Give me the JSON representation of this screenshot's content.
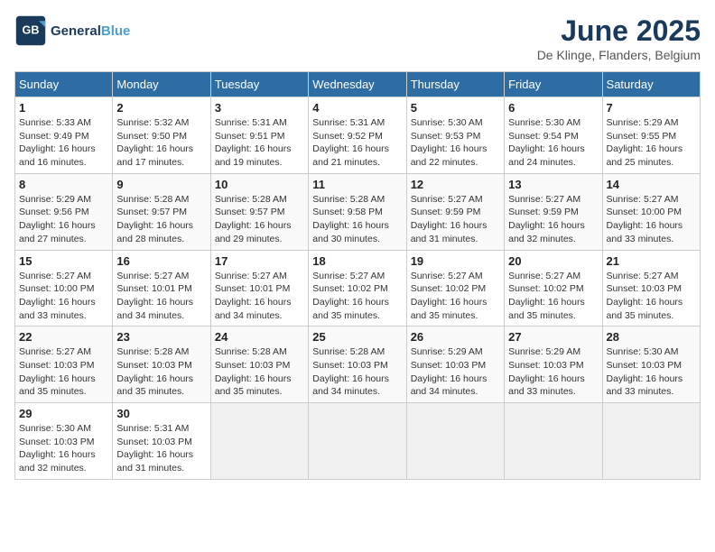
{
  "header": {
    "logo_general": "General",
    "logo_blue": "Blue",
    "month_title": "June 2025",
    "location": "De Klinge, Flanders, Belgium"
  },
  "days_of_week": [
    "Sunday",
    "Monday",
    "Tuesday",
    "Wednesday",
    "Thursday",
    "Friday",
    "Saturday"
  ],
  "weeks": [
    [
      {
        "day": "1",
        "sunrise": "5:33 AM",
        "sunset": "9:49 PM",
        "daylight": "16 hours and 16 minutes."
      },
      {
        "day": "2",
        "sunrise": "5:32 AM",
        "sunset": "9:50 PM",
        "daylight": "16 hours and 17 minutes."
      },
      {
        "day": "3",
        "sunrise": "5:31 AM",
        "sunset": "9:51 PM",
        "daylight": "16 hours and 19 minutes."
      },
      {
        "day": "4",
        "sunrise": "5:31 AM",
        "sunset": "9:52 PM",
        "daylight": "16 hours and 21 minutes."
      },
      {
        "day": "5",
        "sunrise": "5:30 AM",
        "sunset": "9:53 PM",
        "daylight": "16 hours and 22 minutes."
      },
      {
        "day": "6",
        "sunrise": "5:30 AM",
        "sunset": "9:54 PM",
        "daylight": "16 hours and 24 minutes."
      },
      {
        "day": "7",
        "sunrise": "5:29 AM",
        "sunset": "9:55 PM",
        "daylight": "16 hours and 25 minutes."
      }
    ],
    [
      {
        "day": "8",
        "sunrise": "5:29 AM",
        "sunset": "9:56 PM",
        "daylight": "16 hours and 27 minutes."
      },
      {
        "day": "9",
        "sunrise": "5:28 AM",
        "sunset": "9:57 PM",
        "daylight": "16 hours and 28 minutes."
      },
      {
        "day": "10",
        "sunrise": "5:28 AM",
        "sunset": "9:57 PM",
        "daylight": "16 hours and 29 minutes."
      },
      {
        "day": "11",
        "sunrise": "5:28 AM",
        "sunset": "9:58 PM",
        "daylight": "16 hours and 30 minutes."
      },
      {
        "day": "12",
        "sunrise": "5:27 AM",
        "sunset": "9:59 PM",
        "daylight": "16 hours and 31 minutes."
      },
      {
        "day": "13",
        "sunrise": "5:27 AM",
        "sunset": "9:59 PM",
        "daylight": "16 hours and 32 minutes."
      },
      {
        "day": "14",
        "sunrise": "5:27 AM",
        "sunset": "10:00 PM",
        "daylight": "16 hours and 33 minutes."
      }
    ],
    [
      {
        "day": "15",
        "sunrise": "5:27 AM",
        "sunset": "10:00 PM",
        "daylight": "16 hours and 33 minutes."
      },
      {
        "day": "16",
        "sunrise": "5:27 AM",
        "sunset": "10:01 PM",
        "daylight": "16 hours and 34 minutes."
      },
      {
        "day": "17",
        "sunrise": "5:27 AM",
        "sunset": "10:01 PM",
        "daylight": "16 hours and 34 minutes."
      },
      {
        "day": "18",
        "sunrise": "5:27 AM",
        "sunset": "10:02 PM",
        "daylight": "16 hours and 35 minutes."
      },
      {
        "day": "19",
        "sunrise": "5:27 AM",
        "sunset": "10:02 PM",
        "daylight": "16 hours and 35 minutes."
      },
      {
        "day": "20",
        "sunrise": "5:27 AM",
        "sunset": "10:02 PM",
        "daylight": "16 hours and 35 minutes."
      },
      {
        "day": "21",
        "sunrise": "5:27 AM",
        "sunset": "10:03 PM",
        "daylight": "16 hours and 35 minutes."
      }
    ],
    [
      {
        "day": "22",
        "sunrise": "5:27 AM",
        "sunset": "10:03 PM",
        "daylight": "16 hours and 35 minutes."
      },
      {
        "day": "23",
        "sunrise": "5:28 AM",
        "sunset": "10:03 PM",
        "daylight": "16 hours and 35 minutes."
      },
      {
        "day": "24",
        "sunrise": "5:28 AM",
        "sunset": "10:03 PM",
        "daylight": "16 hours and 35 minutes."
      },
      {
        "day": "25",
        "sunrise": "5:28 AM",
        "sunset": "10:03 PM",
        "daylight": "16 hours and 34 minutes."
      },
      {
        "day": "26",
        "sunrise": "5:29 AM",
        "sunset": "10:03 PM",
        "daylight": "16 hours and 34 minutes."
      },
      {
        "day": "27",
        "sunrise": "5:29 AM",
        "sunset": "10:03 PM",
        "daylight": "16 hours and 33 minutes."
      },
      {
        "day": "28",
        "sunrise": "5:30 AM",
        "sunset": "10:03 PM",
        "daylight": "16 hours and 33 minutes."
      }
    ],
    [
      {
        "day": "29",
        "sunrise": "5:30 AM",
        "sunset": "10:03 PM",
        "daylight": "16 hours and 32 minutes."
      },
      {
        "day": "30",
        "sunrise": "5:31 AM",
        "sunset": "10:03 PM",
        "daylight": "16 hours and 31 minutes."
      },
      null,
      null,
      null,
      null,
      null
    ]
  ],
  "labels": {
    "sunrise_label": "Sunrise:",
    "sunset_label": "Sunset:",
    "daylight_label": "Daylight:"
  }
}
